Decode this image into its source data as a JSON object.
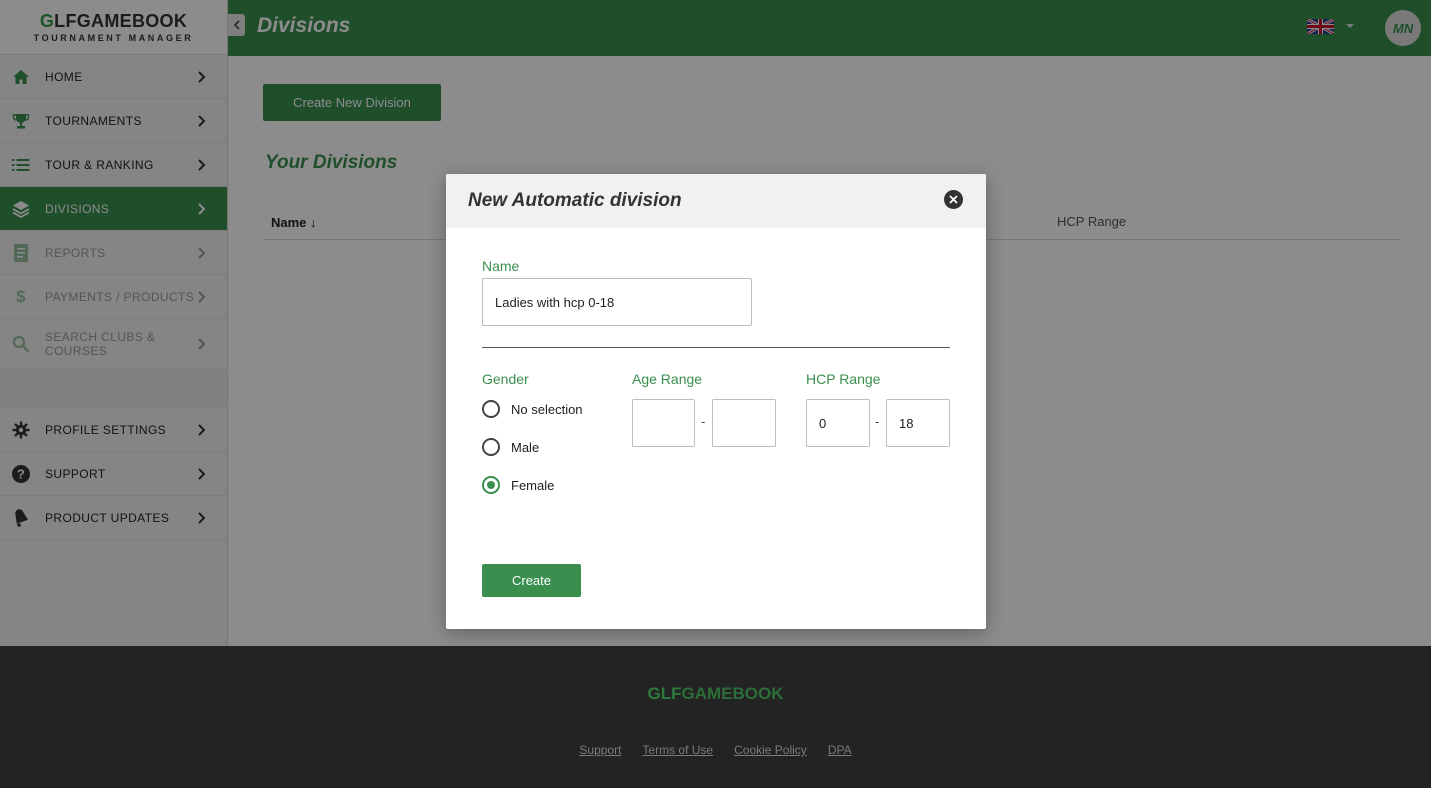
{
  "logo": {
    "part1": "G",
    "part2": "LF",
    "part3": "GAME",
    "part4": "BOOK",
    "subtitle": "TOURNAMENT MANAGER"
  },
  "sidebar": {
    "items": [
      {
        "label": "HOME",
        "icon": "home-icon"
      },
      {
        "label": "TOURNAMENTS",
        "icon": "trophy-icon"
      },
      {
        "label": "TOUR & RANKING",
        "icon": "list-icon"
      },
      {
        "label": "DIVISIONS",
        "icon": "layers-icon"
      },
      {
        "label": "REPORTS",
        "icon": "report-icon"
      },
      {
        "label": "PAYMENTS / PRODUCTS",
        "icon": "dollar-icon"
      },
      {
        "label": "SEARCH CLUBS & COURSES",
        "icon": "search-icon"
      },
      {
        "label": "PROFILE SETTINGS",
        "icon": "gear-icon"
      },
      {
        "label": "SUPPORT",
        "icon": "help-icon"
      },
      {
        "label": "PRODUCT UPDATES",
        "icon": "bell-icon"
      }
    ]
  },
  "header": {
    "title": "Divisions",
    "avatar_initials": "MN"
  },
  "main": {
    "create_button": "Create New Division",
    "section_title": "Your Divisions",
    "columns": {
      "name": "Name ↓",
      "hcp": "HCP Range"
    }
  },
  "modal": {
    "title": "New Automatic division",
    "name_label": "Name",
    "name_value": "Ladies with hcp 0-18",
    "gender_label": "Gender",
    "gender_options": [
      "No selection",
      "Male",
      "Female"
    ],
    "gender_selected": "Female",
    "age_label": "Age Range",
    "age_from": "",
    "age_to": "",
    "hcp_label": "HCP Range",
    "hcp_from": "0",
    "hcp_to": "18",
    "range_separator": "-",
    "create_button": "Create"
  },
  "footer": {
    "logo_a": "G",
    "logo_b": "LF",
    "logo_c": "GAME",
    "logo_d": "BOOK",
    "links": [
      "Support",
      "Terms of Use",
      "Cookie Policy",
      "DPA"
    ]
  },
  "colors": {
    "brand_green": "#3a8f4e",
    "footer_bg": "#2c2c2c"
  }
}
